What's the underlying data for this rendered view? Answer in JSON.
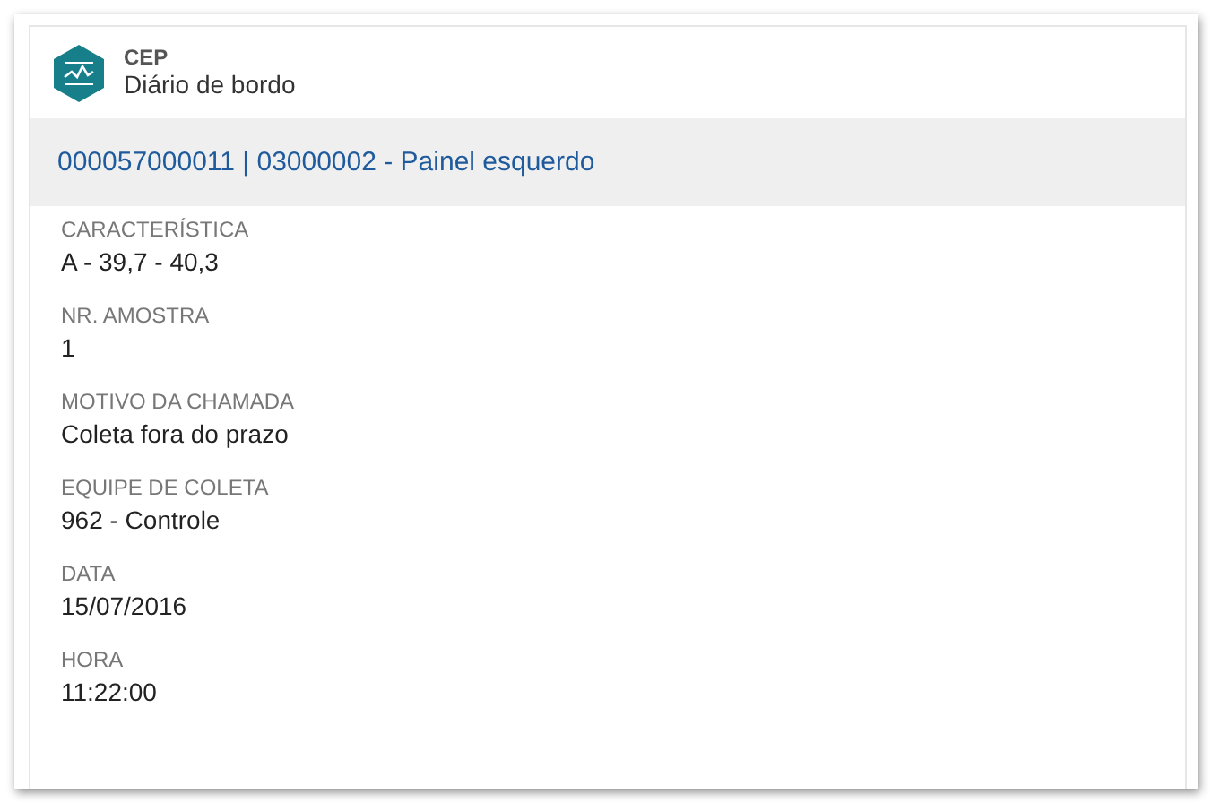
{
  "app": {
    "name": "CEP",
    "subtitle": "Diário de bordo"
  },
  "record_title": "000057000011 | 03000002 - Painel esquerdo",
  "fields": [
    {
      "label": "CARACTERÍSTICA",
      "value": "A - 39,7 - 40,3"
    },
    {
      "label": "NR. AMOSTRA",
      "value": "1"
    },
    {
      "label": "MOTIVO DA CHAMADA",
      "value": "Coleta fora do prazo"
    },
    {
      "label": "EQUIPE DE COLETA",
      "value": "962 - Controle"
    },
    {
      "label": "DATA",
      "value": "15/07/2016"
    },
    {
      "label": "HORA",
      "value": "11:22:00"
    }
  ]
}
